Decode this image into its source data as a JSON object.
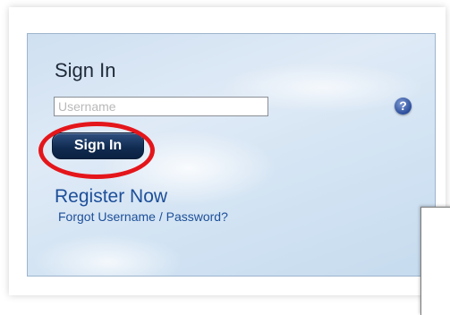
{
  "signin": {
    "title": "Sign In",
    "username_placeholder": "Username",
    "help_glyph": "?",
    "signin_label": "Sign In",
    "register_label": "Register Now",
    "forgot_label": "Forgot Username / Password?"
  },
  "colors": {
    "button_bg": "#102a4f",
    "link": "#1d4f99",
    "highlight": "#e4161b",
    "help_icon": "#2a4d9b"
  },
  "icons": {
    "help": "help-icon"
  }
}
